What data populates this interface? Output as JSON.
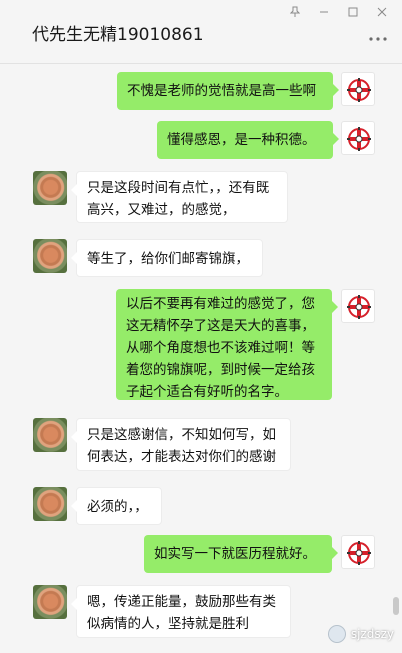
{
  "window": {
    "title": "代先生无精19010861",
    "controls": {
      "pin_icon": "pin-icon",
      "minimize_icon": "minimize-icon",
      "maximize_icon": "maximize-icon",
      "close_icon": "close-icon"
    },
    "more_icon": "more-dots-icon"
  },
  "messages": [
    {
      "side": "right",
      "text": "不愧是老师的觉悟就是高一些啊"
    },
    {
      "side": "right",
      "text": "懂得感恩，是一种积德。"
    },
    {
      "side": "left",
      "text": "只是这段时间有点忙，，还有既高兴，又难过，的感觉，"
    },
    {
      "side": "left",
      "text": "等生了，给你们邮寄锦旗，"
    },
    {
      "side": "right",
      "text": "以后不要再有难过的感觉了，您这无精怀孕了这是天大的喜事，从哪个角度想也不该难过啊！等着您的锦旗呢，到时候一定给孩子起个适合有好听的名字。"
    },
    {
      "side": "left",
      "text": "只是这感谢信，不知如何写，如何表达，才能表达对你们的感谢"
    },
    {
      "side": "left",
      "text": "必须的，，"
    },
    {
      "side": "right",
      "text": "如实写一下就医历程就好。"
    },
    {
      "side": "left",
      "text": "嗯，传递正能量，鼓励那些有类似病情的人，坚持就是胜利"
    }
  ],
  "watermark": {
    "text": "sjzdszy"
  },
  "colors": {
    "background": "#f5f5f5",
    "bubble_self": "#95ec69",
    "bubble_other": "#ffffff",
    "logo_red": "#d6212b"
  }
}
